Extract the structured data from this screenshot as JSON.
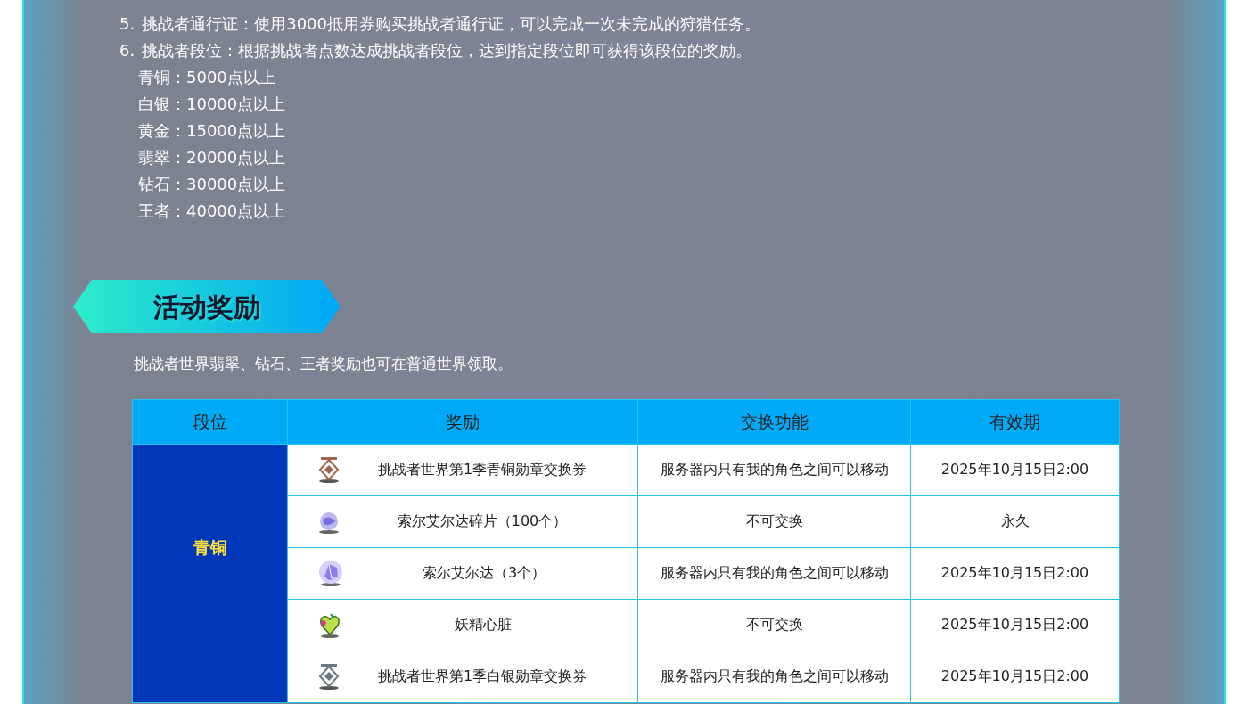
{
  "rules": [
    {
      "number": "5.",
      "text": "挑战者通行证：使用3000抵用券购买挑战者通行证，可以完成一次未完成的狩猎任务。"
    },
    {
      "number": "6.",
      "text": "挑战者段位：根据挑战者点数达成挑战者段位，达到指定段位即可获得该段位的奖励。"
    }
  ],
  "tiers": [
    "青铜：5000点以上",
    "白银：10000点以上",
    "黄金：15000点以上",
    "翡翠：20000点以上",
    "钻石：30000点以上",
    "王者：40000点以上"
  ],
  "section_title": "活动奖励",
  "note": "挑战者世界翡翠、钻石、王者奖励也可在普通世界领取。",
  "table": {
    "columns": [
      "段位",
      "奖励",
      "交换功能",
      "有效期"
    ],
    "groups": [
      {
        "tier": "青铜",
        "rows": [
          {
            "kind": "bronze-medal",
            "reward": "挑战者世界第1季青铜勋章交换券",
            "exchange": "服务器内只有我的角色之间可以移动",
            "validity": "2025年10月15日2:00"
          },
          {
            "kind": "shard",
            "reward": "索尔艾尔达碎片（100个）",
            "exchange": "不可交换",
            "validity": "永久"
          },
          {
            "kind": "crystal",
            "reward": "索尔艾尔达（3个）",
            "exchange": "服务器内只有我的角色之间可以移动",
            "validity": "2025年10月15日2:00"
          },
          {
            "kind": "heart",
            "reward": "妖精心脏",
            "exchange": "不可交换",
            "validity": "2025年10月15日2:00"
          }
        ]
      },
      {
        "rows": [
          {
            "kind": "silver-medal",
            "reward": "挑战者世界第1季白银勋章交换券",
            "exchange": "服务器内只有我的角色之间可以移动",
            "validity": "2025年10月15日2:00"
          }
        ]
      }
    ]
  }
}
